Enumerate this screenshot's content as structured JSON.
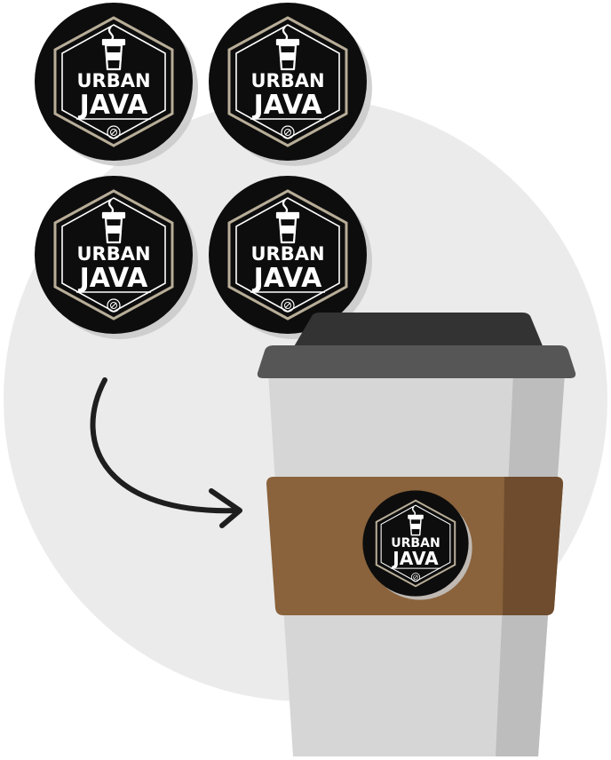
{
  "sticker": {
    "brand_line1": "URBAN",
    "brand_line2": "JAVA",
    "icon": "coffee-cup-icon",
    "seal_icon": "seal-mark-icon"
  },
  "sheet": {
    "count": 4
  },
  "cup": {
    "icon": "takeaway-coffee-cup",
    "sleeve_color": "#8a623b",
    "lid_color": "#3a3a3a"
  },
  "arrow": {
    "icon": "curved-arrow-icon"
  },
  "colors": {
    "background_circle": "#ebebeb",
    "sticker_bg": "#111111",
    "sticker_border": "#b8ad98",
    "logo_text": "#ffffff"
  }
}
